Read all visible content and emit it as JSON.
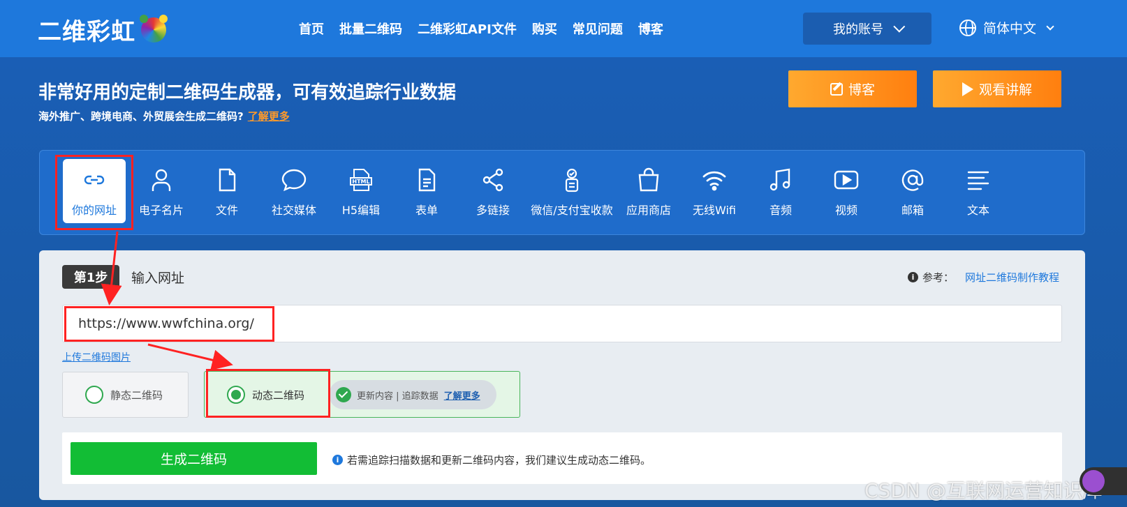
{
  "brand": {
    "logo_text": "二维彩虹"
  },
  "nav": {
    "links": [
      "首页",
      "批量二维码",
      "二维彩虹API文件",
      "购买",
      "常见问题",
      "博客"
    ],
    "account": "我的账号",
    "language": "简体中文"
  },
  "hero": {
    "title": "非常好用的定制二维码生成器，可有效追踪行业数据",
    "subtitle": "海外推广、跨境电商、外贸展会生成二维码?",
    "learn_more": "了解更多",
    "blog_button": "博客",
    "watch_button": "观看讲解"
  },
  "categories": [
    {
      "label": "你的网址",
      "icon": "link-icon",
      "active": true
    },
    {
      "label": "电子名片",
      "icon": "user-icon"
    },
    {
      "label": "文件",
      "icon": "file-icon"
    },
    {
      "label": "社交媒体",
      "icon": "chat-bubble-icon"
    },
    {
      "label": "H5编辑",
      "icon": "html-icon"
    },
    {
      "label": "表单",
      "icon": "form-icon"
    },
    {
      "label": "多链接",
      "icon": "share-icon"
    },
    {
      "label": "微信/支付宝收款",
      "icon": "payment-icon"
    },
    {
      "label": "应用商店",
      "icon": "shopping-bag-icon"
    },
    {
      "label": "无线Wifi",
      "icon": "wifi-icon"
    },
    {
      "label": "音频",
      "icon": "music-icon"
    },
    {
      "label": "视频",
      "icon": "video-icon"
    },
    {
      "label": "邮箱",
      "icon": "at-icon"
    },
    {
      "label": "文本",
      "icon": "text-icon"
    }
  ],
  "step": {
    "badge": "第1步",
    "label": "输入网址",
    "ref_prefix": "参考：",
    "ref_link": "网址二维码制作教程"
  },
  "url_input": {
    "value": "https://www.wwfchina.org/"
  },
  "upload_link": "上传二维码图片",
  "options": {
    "static": "静态二维码",
    "dynamic": "动态二维码",
    "dynamic_features": "更新内容 | 追踪数据",
    "dynamic_learn_more": "了解更多"
  },
  "generate": {
    "button": "生成二维码",
    "tip": "若需追踪扫描数据和更新二维码内容，我们建议生成动态二维码。"
  },
  "watermark": "CSDN @互联网运营知识库",
  "colors": {
    "primary": "#1e78dc",
    "orange": "#ff8c1a",
    "green": "#12bd35",
    "annotation_red": "#ff2222"
  }
}
